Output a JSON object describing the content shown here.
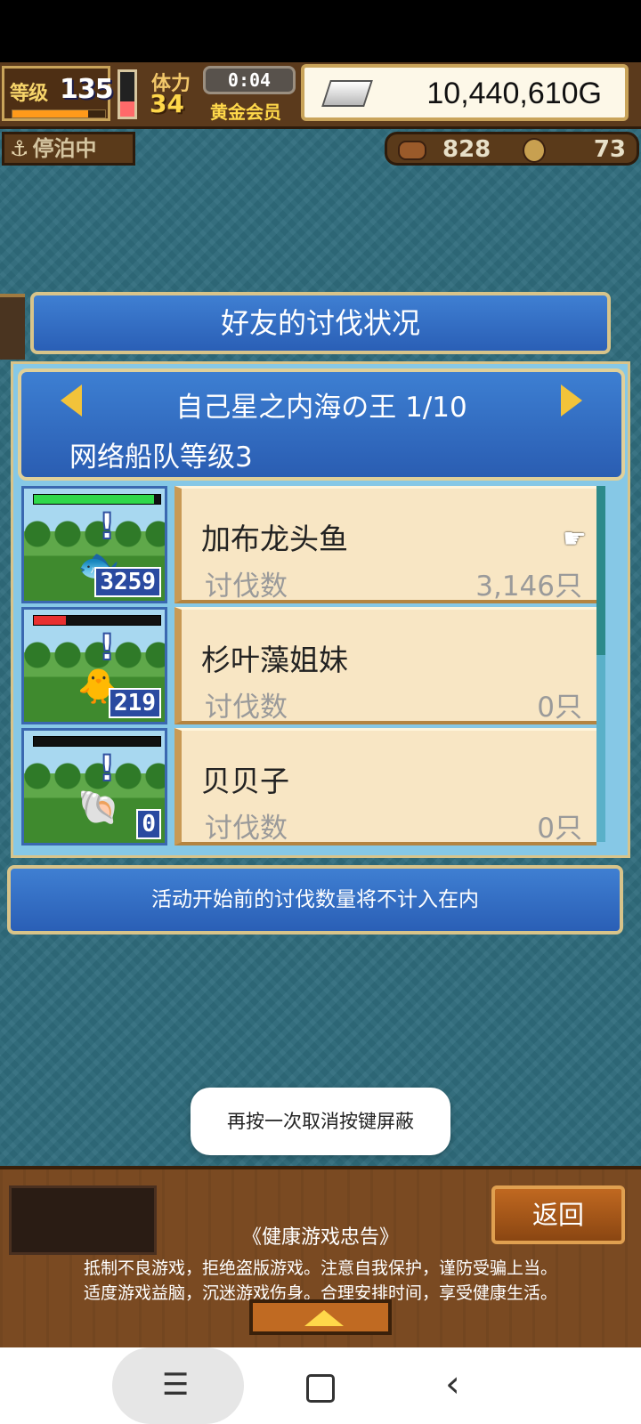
{
  "hud": {
    "level_label": "等级",
    "level": "135",
    "exp_progress": 0.82,
    "stamina_label": "体力",
    "stamina": "34",
    "stamina_fill": 0.35,
    "timer": "0:04",
    "member_status": "黄金会员",
    "gold": "10,440,610G"
  },
  "status": {
    "anchor_label": "停泊中",
    "wood": "828",
    "medals": "73"
  },
  "panel": {
    "title": "好友的讨伐状况",
    "event_title": "自己星之内海の王 1/10",
    "fleet_rank": "网络船队等级3",
    "rows": [
      {
        "name": "加布龙头鱼",
        "kill_label": "讨伐数",
        "kill_value": "3,146只",
        "remaining": "3259",
        "hp": 0.95
      },
      {
        "name": "杉叶藻姐妹",
        "kill_label": "讨伐数",
        "kill_value": "0只",
        "remaining": "219",
        "hp": 0.25
      },
      {
        "name": "贝贝子",
        "kill_label": "讨伐数",
        "kill_value": "0只",
        "remaining": "0",
        "hp": 0.0
      }
    ],
    "notice": "活动开始前的讨伐数量将不计入在内"
  },
  "toast": "再按一次取消按键屏蔽",
  "footer": {
    "back_label": "返回",
    "advice_title": "《健康游戏忠告》",
    "advice_line1": "抵制不良游戏，拒绝盗版游戏。注意自我保护，谨防受骗上当。",
    "advice_line2": "适度游戏益脑，沉迷游戏伤身。合理安排时间，享受健康生活。"
  },
  "colors": {
    "panel_blue": "#2a5fb6",
    "card_bg": "#f8e6c4",
    "wood": "#7a4a22",
    "gold_text": "#ffd84a"
  },
  "icons": {
    "anchor": "anchor-icon",
    "wood": "wood-icon",
    "medal": "medal-icon",
    "ingot": "gold-ingot-icon",
    "pointer": "hand-pointer-icon"
  }
}
